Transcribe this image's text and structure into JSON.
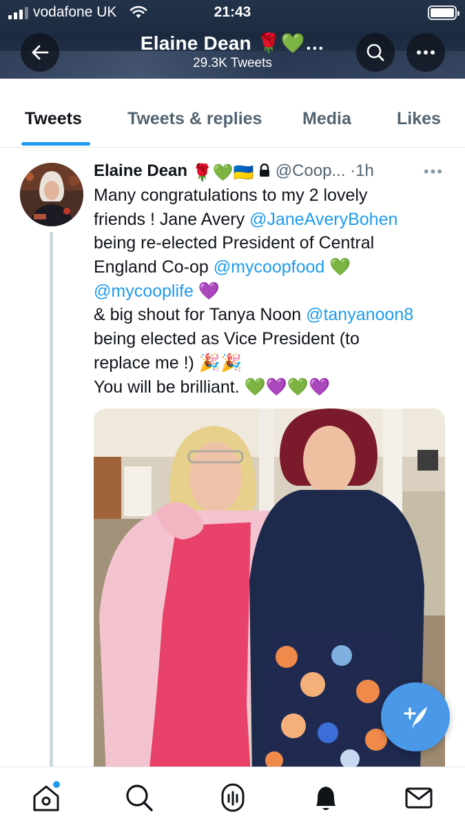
{
  "status_bar": {
    "carrier": "vodafone UK",
    "time": "21:43"
  },
  "header": {
    "name": "Elaine Dean",
    "name_emoji": "🌹💚…",
    "tweet_count": "29.3K Tweets"
  },
  "tabs": [
    {
      "label": "Tweets",
      "active": true
    },
    {
      "label": "Tweets & replies",
      "active": false
    },
    {
      "label": "Media",
      "active": false
    },
    {
      "label": "Likes",
      "active": false
    }
  ],
  "tweet": {
    "author": "Elaine Dean",
    "author_emoji": "🌹💚🇺🇦",
    "handle": "@Coop...",
    "separator": "·",
    "time": "1h",
    "more": "•••",
    "lines": [
      {
        "segments": [
          {
            "text": "Many congratulations to my 2 lovely",
            "type": "text"
          }
        ]
      },
      {
        "segments": [
          {
            "text": "friends ! Jane Avery ",
            "type": "text"
          },
          {
            "text": "@JaneAveryBohen",
            "type": "mention"
          }
        ]
      },
      {
        "segments": [
          {
            "text": "being re-elected President of Central",
            "type": "text"
          }
        ]
      },
      {
        "segments": [
          {
            "text": "England Co-op ",
            "type": "text"
          },
          {
            "text": "@mycoopfood",
            "type": "mention"
          },
          {
            "text": " 💚",
            "type": "text"
          }
        ]
      },
      {
        "segments": [
          {
            "text": "@mycooplife",
            "type": "mention"
          },
          {
            "text": " 💜",
            "type": "text"
          }
        ]
      },
      {
        "segments": [
          {
            "text": "& big shout for Tanya Noon ",
            "type": "text"
          },
          {
            "text": "@tanyanoon8",
            "type": "mention"
          }
        ]
      },
      {
        "segments": [
          {
            "text": "being elected as Vice President (to",
            "type": "text"
          }
        ]
      },
      {
        "segments": [
          {
            "text": "replace me !) 🎉🎉",
            "type": "text"
          }
        ]
      },
      {
        "segments": [
          {
            "text": "You will be brilliant. 💚💜💚💜",
            "type": "text"
          }
        ]
      }
    ]
  },
  "colors": {
    "accent": "#1d9bf0",
    "fab": "#4a99e9",
    "header_bg": "#1b2a3f",
    "text_primary": "#0f1419",
    "text_secondary": "#536471",
    "divider": "#e1e8ed"
  },
  "icons": {
    "header": [
      "back-arrow-icon",
      "search-icon",
      "more-icon"
    ],
    "bottom_nav": [
      "home-icon",
      "search-icon",
      "spaces-icon",
      "notifications-icon",
      "messages-icon"
    ],
    "fab": "compose-tweet-icon"
  }
}
